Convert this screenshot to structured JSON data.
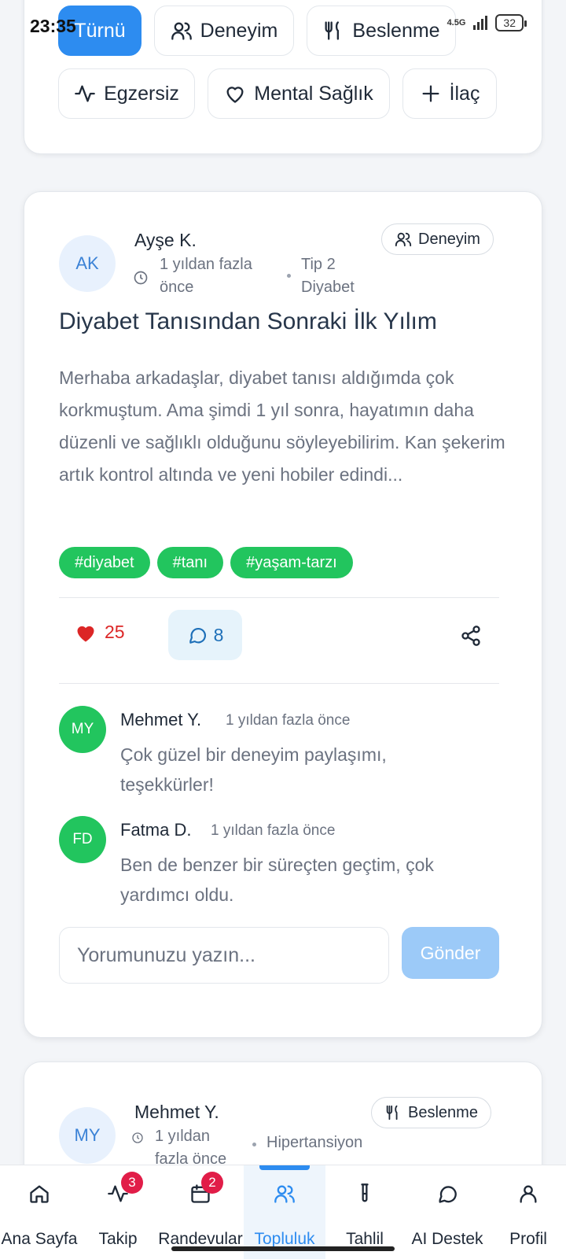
{
  "status_bar": {
    "time": "23:35",
    "network": "4.5G",
    "battery": "32"
  },
  "filters": {
    "row1": [
      {
        "label": "Türnü",
        "active": true
      },
      {
        "label": "Deneyim",
        "icon": "users-icon"
      },
      {
        "label": "Beslenme",
        "icon": "utensils-icon"
      }
    ],
    "row2": [
      {
        "label": "Egzersiz",
        "icon": "activity-icon"
      },
      {
        "label": "Mental Sağlık",
        "icon": "heart-icon"
      },
      {
        "label": "İlaç",
        "icon": "plus-icon"
      }
    ]
  },
  "post": {
    "avatar_initials": "AK",
    "author": "Ayşe K.",
    "time": "1 yıldan fazla önce",
    "condition": "Tip 2 Diyabet",
    "category": "Deneyim",
    "title": "Diyabet Tanısından Sonraki İlk Yılım",
    "body": "Merhaba arkadaşlar, diyabet tanısı aldığımda çok korkmuştum. Ama şimdi 1 yıl sonra, hayatımın daha düzenli ve sağlıklı olduğunu söyleyebilirim. Kan şekerim artık kontrol altında ve yeni hobiler edindi...",
    "tags": [
      "#diyabet",
      "#tanı",
      "#yaşam-tarzı"
    ],
    "likes": "25",
    "comments_count": "8",
    "comments": [
      {
        "initials": "MY",
        "name": "Mehmet Y.",
        "time": "1 yıldan fazla önce",
        "text": "Çok güzel bir deneyim paylaşımı, teşekkürler!"
      },
      {
        "initials": "FD",
        "name": "Fatma D.",
        "time": "1 yıldan fazla önce",
        "text": "Ben de benzer bir süreçten geçtim, çok yardımcı oldu."
      }
    ],
    "comment_placeholder": "Yorumunuzu yazın...",
    "send_label": "Gönder"
  },
  "post2": {
    "avatar_initials": "MY",
    "author": "Mehmet Y.",
    "time": "1 yıldan fazla önce",
    "condition": "Hipertansiyon",
    "category": "Beslenme"
  },
  "nav": {
    "items": [
      {
        "label": "Ana Sayfa",
        "icon": "home-icon"
      },
      {
        "label": "Takip",
        "icon": "activity-icon",
        "badge": "3"
      },
      {
        "label": "Randevular",
        "icon": "calendar-icon",
        "badge": "2"
      },
      {
        "label": "Topluluk",
        "icon": "users-icon",
        "active": true
      },
      {
        "label": "Tahlil",
        "icon": "test-tube-icon"
      },
      {
        "label": "AI Destek",
        "icon": "chat-icon"
      },
      {
        "label": "Profil",
        "icon": "user-icon"
      }
    ]
  },
  "colors": {
    "accent": "#2d8cf0",
    "tag_green": "#22c55e",
    "like_red": "#dc2626",
    "badge_red": "#e11d48"
  }
}
